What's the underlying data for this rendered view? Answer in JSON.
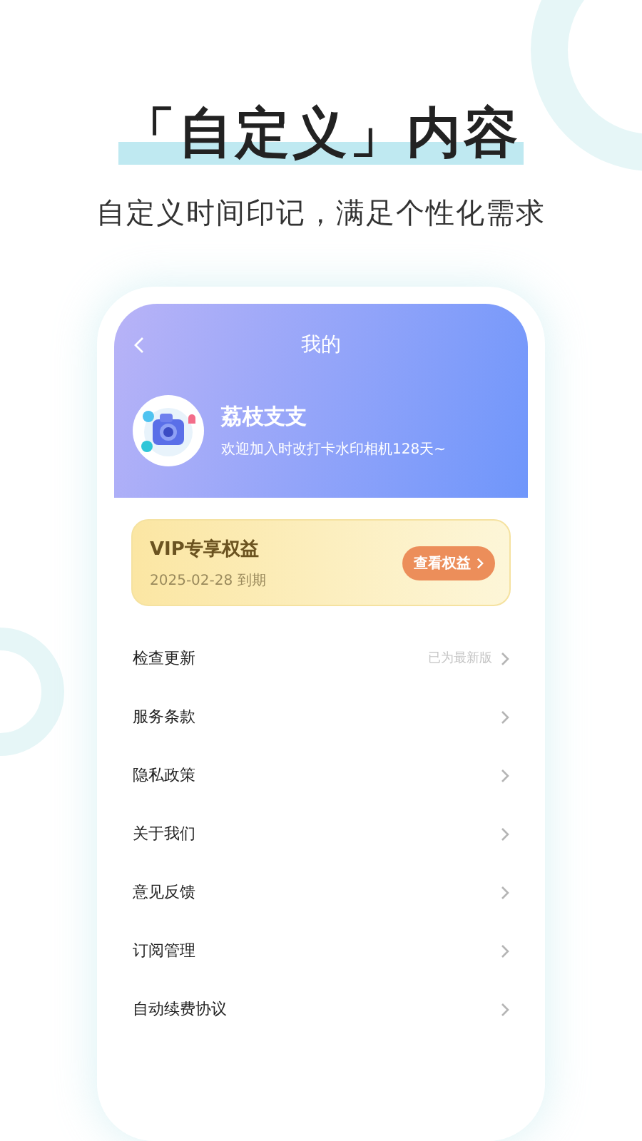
{
  "headline": "「自定义」内容",
  "subtitle": "自定义时间印记，满足个性化需求",
  "screen": {
    "title": "我的",
    "profile": {
      "name": "荔枝支支",
      "greeting": "欢迎加入时改打卡水印相机128天~"
    },
    "vip": {
      "title": "VIP专享权益",
      "expiry": "2025-02-28 到期",
      "button": "查看权益"
    },
    "menu": [
      {
        "label": "检查更新",
        "value": "已为最新版"
      },
      {
        "label": "服务条款"
      },
      {
        "label": "隐私政策"
      },
      {
        "label": "关于我们"
      },
      {
        "label": "意见反馈"
      },
      {
        "label": "订阅管理"
      },
      {
        "label": "自动续费协议"
      }
    ]
  }
}
